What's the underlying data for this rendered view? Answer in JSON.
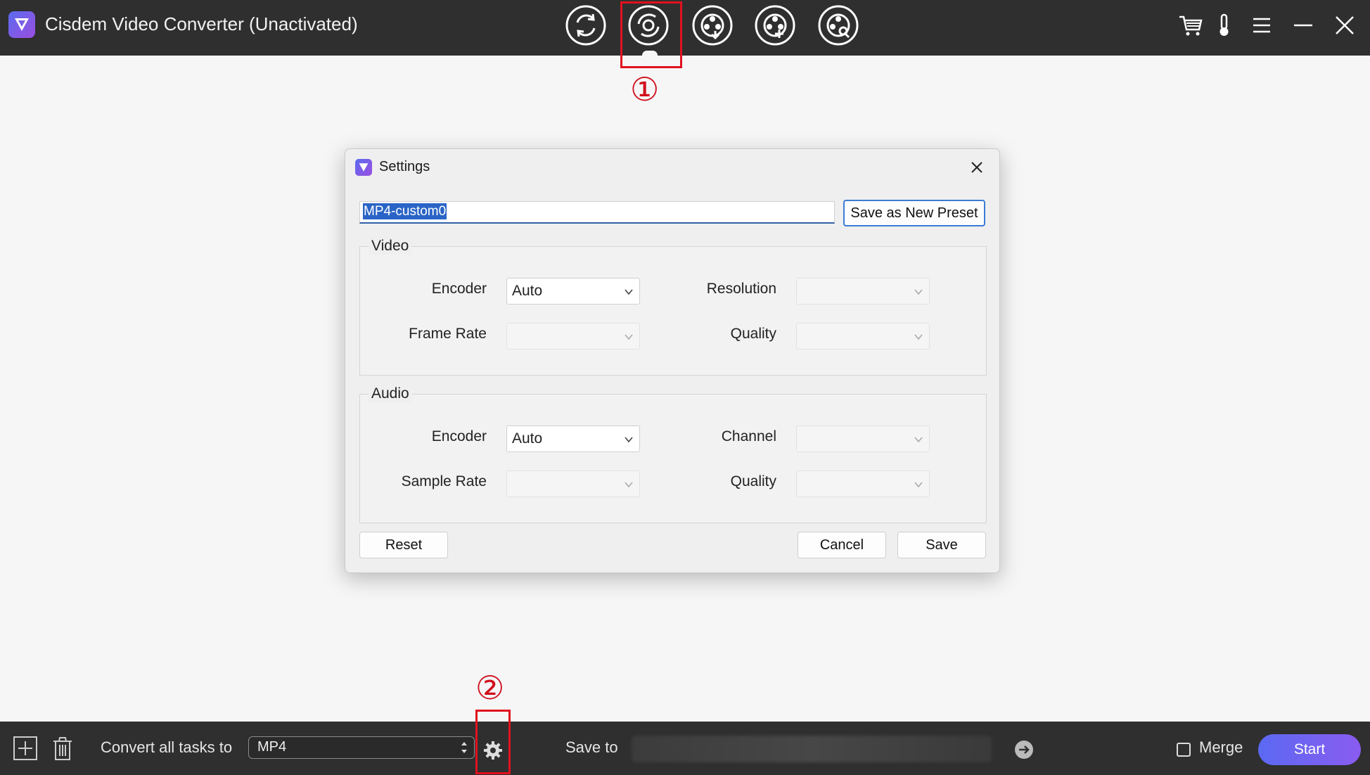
{
  "app": {
    "title": "Cisdem Video Converter (Unactivated)"
  },
  "toolbar": {
    "tools": [
      "convert-icon",
      "rip-icon",
      "download-icon",
      "burn-icon",
      "compress-icon"
    ],
    "active": "rip-icon"
  },
  "annotations": {
    "one": "①",
    "two": "②",
    "color": "#e0121f"
  },
  "dialog": {
    "title": "Settings",
    "preset_name": "MP4-custom0",
    "save_preset_label": "Save as New Preset",
    "video": {
      "label": "Video",
      "encoder_label": "Encoder",
      "encoder_value": "Auto",
      "resolution_label": "Resolution",
      "resolution_value": "",
      "frame_rate_label": "Frame Rate",
      "frame_rate_value": "",
      "quality_label": "Quality",
      "quality_value": ""
    },
    "audio": {
      "label": "Audio",
      "encoder_label": "Encoder",
      "encoder_value": "Auto",
      "channel_label": "Channel",
      "channel_value": "",
      "sample_rate_label": "Sample Rate",
      "sample_rate_value": "",
      "quality_label": "Quality",
      "quality_value": ""
    },
    "reset_label": "Reset",
    "cancel_label": "Cancel",
    "save_label": "Save"
  },
  "bottom": {
    "convert_label": "Convert all tasks to",
    "format_value": "MP4",
    "save_to_label": "Save to",
    "merge_label": "Merge",
    "merge_checked": false,
    "start_label": "Start"
  },
  "colors": {
    "accent": "#3b7bd6",
    "brand_start": "#5b69f2",
    "brand_end": "#8a5cf0"
  }
}
